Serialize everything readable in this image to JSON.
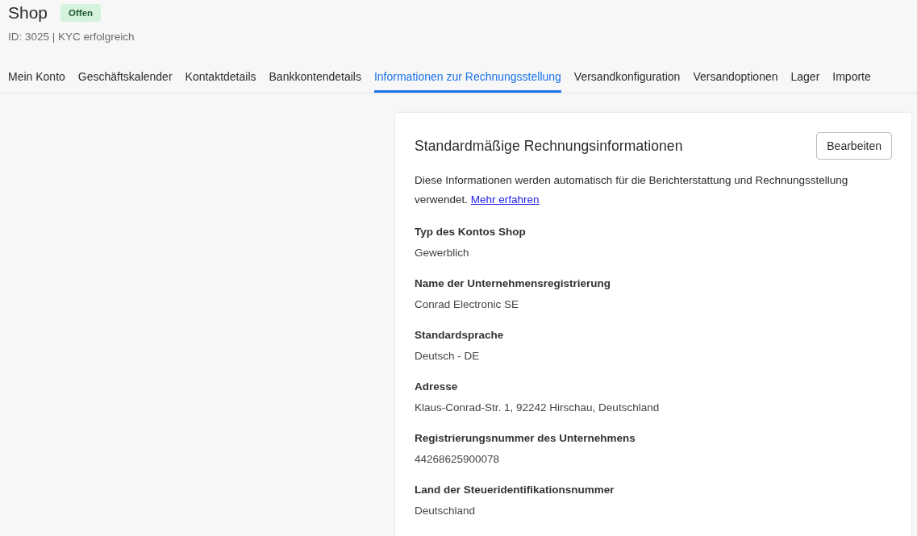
{
  "header": {
    "title": "Shop",
    "status_badge": "Offen",
    "subtitle": "ID: 3025 | KYC erfolgreich"
  },
  "tabs": [
    {
      "label": "Mein Konto",
      "selected": false
    },
    {
      "label": "Geschäftskalender",
      "selected": false
    },
    {
      "label": "Kontaktdetails",
      "selected": false
    },
    {
      "label": "Bankkontendetails",
      "selected": false
    },
    {
      "label": "Informationen zur Rechnungsstellung",
      "selected": true
    },
    {
      "label": "Versandkonfiguration",
      "selected": false
    },
    {
      "label": "Versandoptionen",
      "selected": false
    },
    {
      "label": "Lager",
      "selected": false
    },
    {
      "label": "Importe",
      "selected": false
    }
  ],
  "card": {
    "title": "Standardmäßige Rechnungsinformationen",
    "edit_button": "Bearbeiten",
    "description": "Diese Informationen werden automatisch für die Berichterstattung und Rechnungsstellung verwendet.",
    "link": "Mehr erfahren",
    "fields": [
      {
        "label": "Typ des Kontos Shop",
        "value": "Gewerblich"
      },
      {
        "label": "Name der Unternehmensregistrierung",
        "value": "Conrad Electronic SE"
      },
      {
        "label": "Standardsprache",
        "value": "Deutsch - DE"
      },
      {
        "label": "Adresse",
        "value": "Klaus-Conrad-Str. 1, 92242 Hirschau, Deutschland"
      },
      {
        "label": "Registrierungsnummer des Unternehmens",
        "value": "44268625900078"
      },
      {
        "label": "Land der Steueridentifikationsnummer",
        "value": "Deutschland"
      }
    ]
  }
}
